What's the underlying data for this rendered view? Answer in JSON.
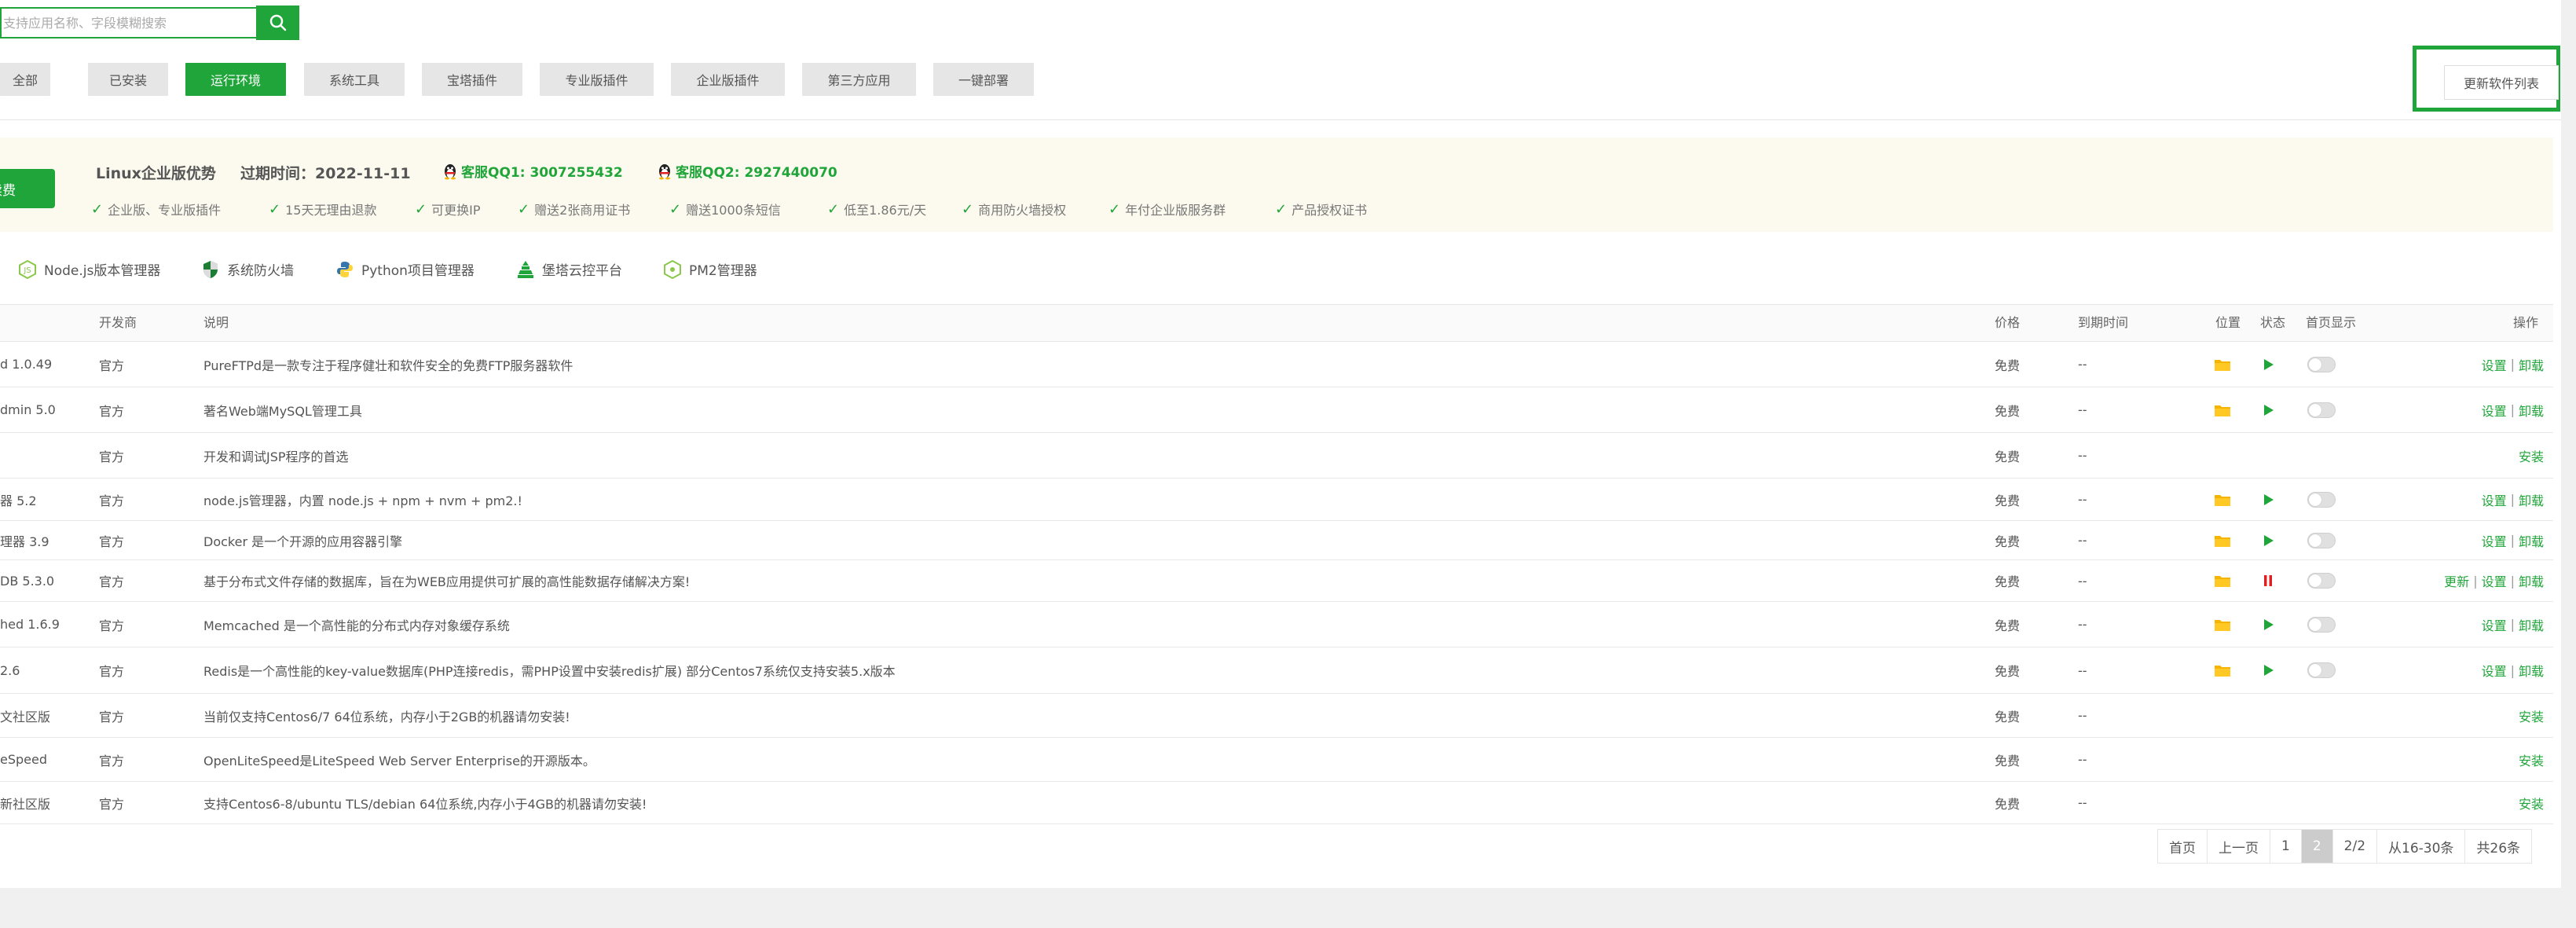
{
  "search": {
    "placeholder": "支持应用名称、字段模糊搜索"
  },
  "tabs": [
    {
      "label": "全部",
      "active": false
    },
    {
      "label": "已安装",
      "active": false
    },
    {
      "label": "运行环境",
      "active": true
    },
    {
      "label": "系统工具",
      "active": false
    },
    {
      "label": "宝塔插件",
      "active": false
    },
    {
      "label": "专业版插件",
      "active": false
    },
    {
      "label": "企业版插件",
      "active": false
    },
    {
      "label": "第三方应用",
      "active": false
    },
    {
      "label": "一键部署",
      "active": false
    }
  ],
  "update_button": "更新软件列表",
  "promo": {
    "renew_label": "续费",
    "title": "Linux企业版优势",
    "expire": "过期时间：2022-11-11",
    "qq1": "客服QQ1: 3007255432",
    "qq2": "客服QQ2: 2927440070",
    "features": [
      "企业版、专业版插件",
      "15天无理由退款",
      "可更换IP",
      "赠送2张商用证书",
      "赠送1000条短信",
      "低至1.86元/天",
      "商用防火墙授权",
      "年付企业版服务群",
      "产品授权证书"
    ]
  },
  "quick_apps": [
    "Node.js版本管理器",
    "系统防火墙",
    "Python项目管理器",
    "堡塔云控平台",
    "PM2管理器"
  ],
  "table": {
    "headers": {
      "developer": "开发商",
      "desc": "说明",
      "price": "价格",
      "expire": "到期时间",
      "location": "位置",
      "status": "状态",
      "home": "首页显示",
      "ops": "操作"
    },
    "rows": [
      {
        "name": "d 1.0.49",
        "developer": "官方",
        "desc": "PureFTPd是一款专注于程序健壮和软件安全的免费FTP服务器软件",
        "price": "免费",
        "expire": "--",
        "installed": true,
        "status": "running",
        "ops": [
          "设置",
          "卸载"
        ]
      },
      {
        "name": "dmin 5.0",
        "developer": "官方",
        "desc": "著名Web端MySQL管理工具",
        "price": "免费",
        "expire": "--",
        "installed": true,
        "status": "running",
        "ops": [
          "设置",
          "卸载"
        ]
      },
      {
        "name": "",
        "developer": "官方",
        "desc": "开发和调试JSP程序的首选",
        "price": "免费",
        "expire": "--",
        "installed": false,
        "status": "",
        "ops": [
          "安装"
        ]
      },
      {
        "name": "器 5.2",
        "developer": "官方",
        "desc": "node.js管理器，内置 node.js + npm + nvm + pm2.!",
        "price": "免费",
        "expire": "--",
        "installed": true,
        "status": "running",
        "ops": [
          "设置",
          "卸载"
        ]
      },
      {
        "name": "理器 3.9",
        "developer": "官方",
        "desc": "Docker 是一个开源的应用容器引擎",
        "price": "免费",
        "expire": "--",
        "installed": true,
        "status": "running",
        "ops": [
          "设置",
          "卸载"
        ]
      },
      {
        "name": "DB 5.3.0",
        "developer": "官方",
        "desc": "基于分布式文件存储的数据库，旨在为WEB应用提供可扩展的高性能数据存储解决方案!",
        "price": "免费",
        "expire": "--",
        "installed": true,
        "status": "stopped",
        "ops": [
          "更新",
          "设置",
          "卸载"
        ]
      },
      {
        "name": "hed 1.6.9",
        "developer": "官方",
        "desc": "Memcached 是一个高性能的分布式内存对象缓存系统",
        "price": "免费",
        "expire": "--",
        "installed": true,
        "status": "running",
        "ops": [
          "设置",
          "卸载"
        ]
      },
      {
        "name": "2.6",
        "developer": "官方",
        "desc": "Redis是一个高性能的key-value数据库(PHP连接redis，需PHP设置中安装redis扩展) 部分Centos7系统仅支持安装5.x版本",
        "price": "免费",
        "expire": "--",
        "installed": true,
        "status": "running",
        "ops": [
          "设置",
          "卸载"
        ]
      },
      {
        "name": "文社区版",
        "developer": "官方",
        "desc": "当前仅支持Centos6/7 64位系统，内存小于2GB的机器请勿安装!",
        "price": "免费",
        "expire": "--",
        "installed": false,
        "status": "",
        "ops": [
          "安装"
        ]
      },
      {
        "name": "eSpeed",
        "developer": "官方",
        "desc": "OpenLiteSpeed是LiteSpeed Web Server Enterprise的开源版本。",
        "price": "免费",
        "expire": "--",
        "installed": false,
        "status": "",
        "ops": [
          "安装"
        ]
      },
      {
        "name": "新社区版",
        "developer": "官方",
        "desc": "支持Centos6-8/ubuntu TLS/debian 64位系统,内存小于4GB的机器请勿安装!",
        "price": "免费",
        "expire": "--",
        "installed": false,
        "status": "",
        "ops": [
          "安装"
        ]
      }
    ]
  },
  "pagination": {
    "first": "首页",
    "prev": "上一页",
    "page1": "1",
    "page2": "2",
    "pages": "2/2",
    "range": "从16-30条",
    "total": "共26条"
  },
  "colors": {
    "accent": "#20a53a",
    "folder": "#f4b400",
    "stop": "#e02020"
  },
  "icons": {
    "search": "search-icon",
    "check": "check-icon",
    "qq": "qq-penguin-icon",
    "folder": "folder-icon",
    "play": "play-icon",
    "pause": "pause-icon",
    "toggle": "toggle-switch"
  }
}
